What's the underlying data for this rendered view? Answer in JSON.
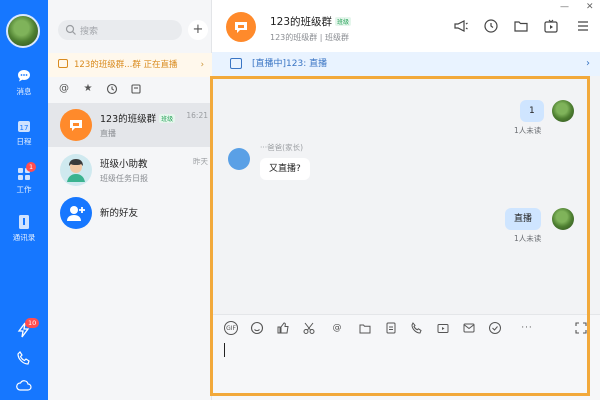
{
  "rail": {
    "items": [
      {
        "label": "消息"
      },
      {
        "label": "日程"
      },
      {
        "label": "工作",
        "badge": "1"
      },
      {
        "label": "通讯录"
      }
    ],
    "bottom_badge": "10"
  },
  "search": {
    "placeholder": "搜索"
  },
  "live_banner": {
    "text": "123的班级群...群 正在直播",
    "arrow": "›"
  },
  "conversations": [
    {
      "name": "123的班级群",
      "tag": "班级",
      "preview": "直播",
      "time": "16:21"
    },
    {
      "name": "班级小助教",
      "preview": "班级任务日报",
      "time": "昨天"
    },
    {
      "name": "新的好友",
      "preview": ""
    }
  ],
  "chat": {
    "title": "123的班级群",
    "tag": "班级",
    "subtitle": "123的班级群 | 班级群",
    "live_strip": "[直播中]123: 直播",
    "live_arrow": "›"
  },
  "messages": [
    {
      "from": "me",
      "text": "1",
      "status": "1人未读"
    },
    {
      "from": "other",
      "sender": "···爸爸(家长)",
      "text": "又直播?"
    },
    {
      "from": "me",
      "text": "直播",
      "status": "1人未读"
    }
  ],
  "colors": {
    "accent": "#1677ff",
    "highlight": "#f2a93b",
    "my_bubble": "#cfe5ff"
  }
}
